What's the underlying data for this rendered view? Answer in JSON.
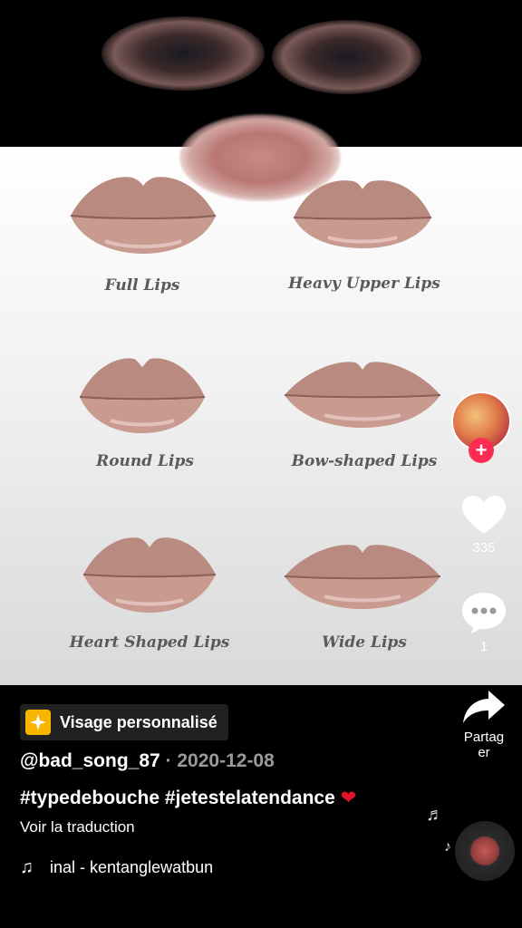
{
  "video": {
    "lip_types": [
      {
        "label": "Full Lips"
      },
      {
        "label": "Heavy Upper Lips"
      },
      {
        "label": "Round Lips"
      },
      {
        "label": "Bow-shaped Lips"
      },
      {
        "label": "Heart Shaped Lips"
      },
      {
        "label": "Wide Lips"
      }
    ]
  },
  "actions": {
    "likes": "335",
    "comments": "1",
    "share_label": "Partag\ner"
  },
  "effect": {
    "label": "Visage personnalisé"
  },
  "post": {
    "author": "@bad_song_87",
    "date_sep": " · ",
    "date": "2020-12-08",
    "caption": "#typedebouche #jetestelatendance ",
    "caption_emoji": "❤",
    "translate_label": "Voir la traduction",
    "music": "inal - kentanglewatbun"
  },
  "colors": {
    "follow_accent": "#fe2c55",
    "heart_emoji": "#e3132c",
    "effect_badge": "#f7b500"
  },
  "icons": [
    "plus-icon",
    "heart-icon",
    "comment-icon",
    "share-icon",
    "sparkle-icon",
    "music-note-icon",
    "music-disc-icon"
  ]
}
